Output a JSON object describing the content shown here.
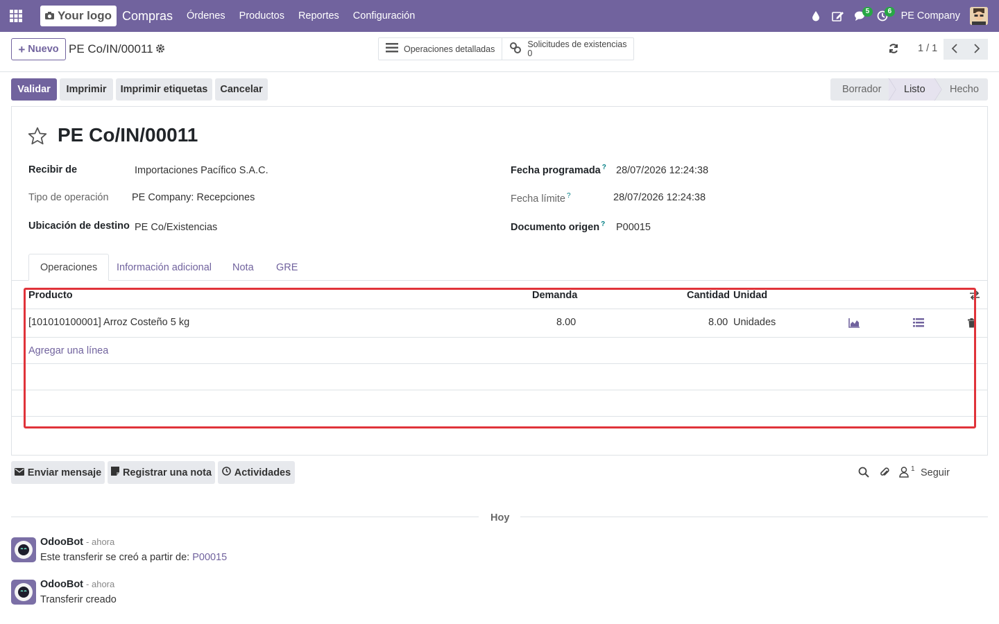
{
  "navbar": {
    "logo_text": "Your logo",
    "app_name": "Compras",
    "menu": [
      "Órdenes",
      "Productos",
      "Reportes",
      "Configuración"
    ],
    "messages_badge": "5",
    "activities_badge": "6",
    "company": "PE Company"
  },
  "control_panel": {
    "new_label": "Nuevo",
    "record_name": "PE Co/IN/00011",
    "smart_buttons": {
      "detailed_ops": "Operaciones detalladas",
      "stock_requests_label": "Solicitudes de existencias",
      "stock_requests_count": "0"
    },
    "pager": "1 / 1"
  },
  "actions": {
    "validate": "Validar",
    "print": "Imprimir",
    "print_labels": "Imprimir etiquetas",
    "cancel": "Cancelar"
  },
  "statusbar": {
    "stages": [
      "Borrador",
      "Listo",
      "Hecho"
    ],
    "current": "Listo"
  },
  "form": {
    "title": "PE Co/IN/00011",
    "receive_from_label": "Recibir de",
    "receive_from": "Importaciones Pacífico S.A.C.",
    "operation_type_label": "Tipo de operación",
    "operation_type": "PE Company: Recepciones",
    "destination_label": "Ubicación de destino",
    "destination": "PE Co/Existencias",
    "scheduled_date_label": "Fecha programada",
    "scheduled_date": "28/07/2026 12:24:38",
    "deadline_label": "Fecha límite",
    "deadline": "28/07/2026 12:24:38",
    "source_doc_label": "Documento origen",
    "source_doc": "P00015",
    "help_mark": "?"
  },
  "tabs": [
    "Operaciones",
    "Información adicional",
    "Nota",
    "GRE"
  ],
  "table": {
    "headers": {
      "product": "Producto",
      "demand": "Demanda",
      "quantity": "Cantidad",
      "unit": "Unidad"
    },
    "rows": [
      {
        "product": "[101010100001] Arroz Costeño 5 kg",
        "demand": "8.00",
        "quantity": "8.00",
        "unit": "Unidades"
      }
    ],
    "add_line": "Agregar una línea"
  },
  "chatter": {
    "send_message": "Enviar mensaje",
    "log_note": "Registrar una nota",
    "activities": "Actividades",
    "followers_count": "1",
    "follow": "Seguir",
    "today": "Hoy",
    "messages": [
      {
        "author": "OdooBot",
        "time": "- ahora",
        "body_prefix": "Este transferir se creó a partir de:",
        "link": "P00015"
      },
      {
        "author": "OdooBot",
        "time": "- ahora",
        "body": "Transferir creado"
      }
    ]
  },
  "colors": {
    "brand": "#71639e",
    "highlight": "#e0333a",
    "badge": "#28a745"
  }
}
